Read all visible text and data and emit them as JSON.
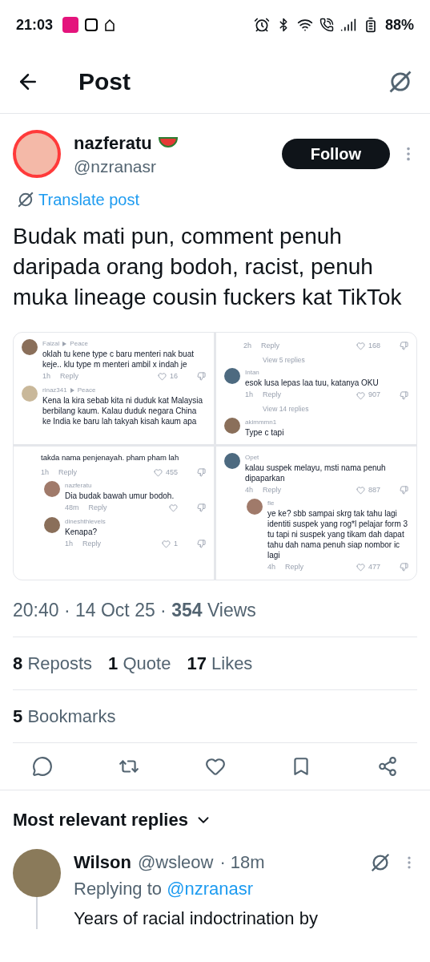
{
  "status_bar": {
    "time": "21:03",
    "battery": "88%"
  },
  "header": {
    "title": "Post"
  },
  "post": {
    "author": "nazferatu",
    "handle": "@nzranasr",
    "follow": "Follow",
    "translate": "Translate post",
    "text": "Budak mati pun, comment penuh daripada orang bodoh, racist, penuh muka lineage cousin fuckers kat TikTok",
    "image_panels": [
      {
        "items": [
          {
            "kind": "comment",
            "user": "Faizal",
            "badge": "Peace",
            "text": "oklah tu kene type c baru menteri nak buat keje.. klu type m menteri ambil x indah je",
            "time": "1h",
            "reply": "Reply",
            "likes": "16",
            "indent": false
          },
          {
            "kind": "comment",
            "user": "rinaz341",
            "badge": "Peace",
            "text": "Kena la kira sebab kita ni duduk kat Malaysia berbilang kaum. Kalau duduk negara China ke India ke baru lah takyah kisah kaum apa",
            "indent": false
          }
        ]
      },
      {
        "items": [
          {
            "kind": "actions",
            "time": "2h",
            "reply": "Reply",
            "likes": "168"
          },
          {
            "kind": "view_replies",
            "text": "View 5 replies"
          },
          {
            "kind": "comment",
            "user": "Intan",
            "text": "esok lusa lepas laa tuu, katanya OKU",
            "time": "1h",
            "reply": "Reply",
            "likes": "907",
            "indent": false
          },
          {
            "kind": "view_replies",
            "text": "View 14 replies"
          },
          {
            "kind": "comment",
            "user": "akimmmn1",
            "text": "Type c tapi",
            "indent": false
          }
        ]
      },
      {
        "items": [
          {
            "kind": "text",
            "text": "takda nama penjenayah. pham pham lah"
          },
          {
            "kind": "actions",
            "time": "1h",
            "reply": "Reply",
            "likes": "455"
          },
          {
            "kind": "comment",
            "user": "nazferatu",
            "text": "Dia budak bawah umur bodoh.",
            "time": "48m",
            "reply": "Reply",
            "indent": true
          },
          {
            "kind": "comment",
            "user": "dineshthlevels",
            "text": "Kenapa?",
            "time": "1h",
            "reply": "Reply",
            "likes": "1",
            "indent": true
          }
        ]
      },
      {
        "items": [
          {
            "kind": "comment",
            "user": "Opet",
            "text": "kalau suspek melayu, msti nama penuh dipaparkan",
            "time": "4h",
            "reply": "Reply",
            "likes": "887",
            "indent": false
          },
          {
            "kind": "comment",
            "user": "fie",
            "text": "ye ke? sbb sampai skrg tak tahu lagi identiti suspek yang rog*l pelajar form 3 tu tapi ni suspek yang tikam dah dapat tahu dah nama penuh siap nombor ic lagi",
            "time": "4h",
            "reply": "Reply",
            "likes": "477",
            "indent": true
          }
        ]
      }
    ],
    "meta": "20:40 · 14 Oct 25 · **354** Views",
    "stats": [
      {
        "count": "8",
        "label": "Reposts"
      },
      {
        "count": "1",
        "label": "Quote"
      },
      {
        "count": "17",
        "label": "Likes"
      }
    ],
    "bookmarks": {
      "count": "5",
      "label": "Bookmarks"
    }
  },
  "replies_header": "Most relevant replies",
  "replies": [
    {
      "author": "Wilson",
      "handle": "@wsleow",
      "time": "· 18m",
      "replying_label": "Replying to",
      "replying_to": "@nzranasr",
      "text": "Years of racial indoctrination by"
    }
  ]
}
